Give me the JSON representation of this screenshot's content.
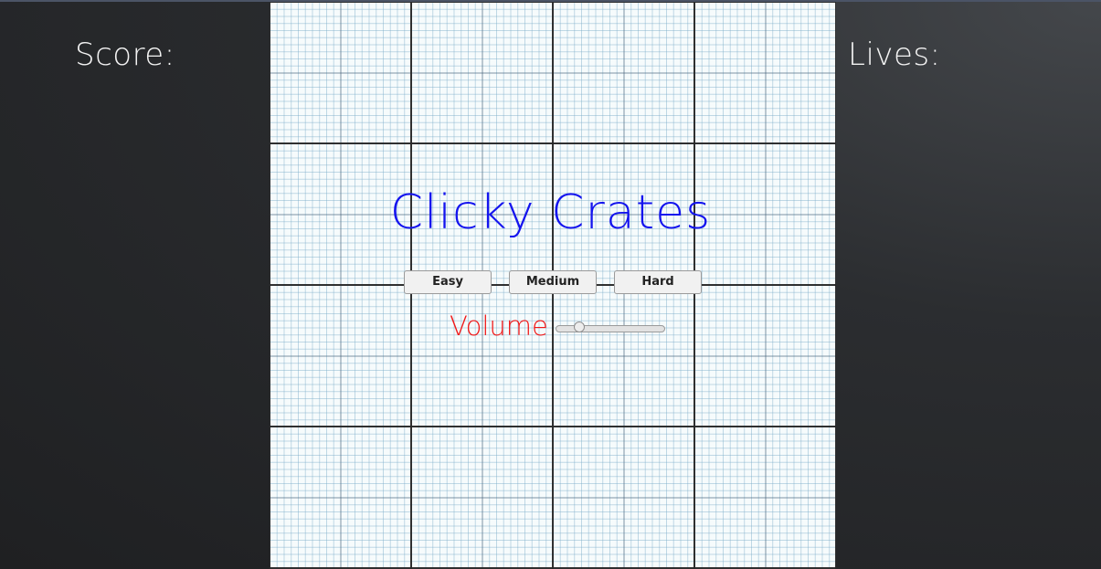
{
  "hud": {
    "score_label": "Score:",
    "lives_label": "Lives:"
  },
  "title": "Clicky Crates",
  "difficulty_buttons": [
    {
      "label": "Easy"
    },
    {
      "label": "Medium"
    },
    {
      "label": "Hard"
    }
  ],
  "volume": {
    "label": "Volume",
    "level": 0.19
  },
  "colors": {
    "title": "#1414ee",
    "volume_label": "#f01818",
    "hud_text": "#f2f2f2",
    "background": "#2b2d30",
    "paper": "#f6fbfc"
  }
}
